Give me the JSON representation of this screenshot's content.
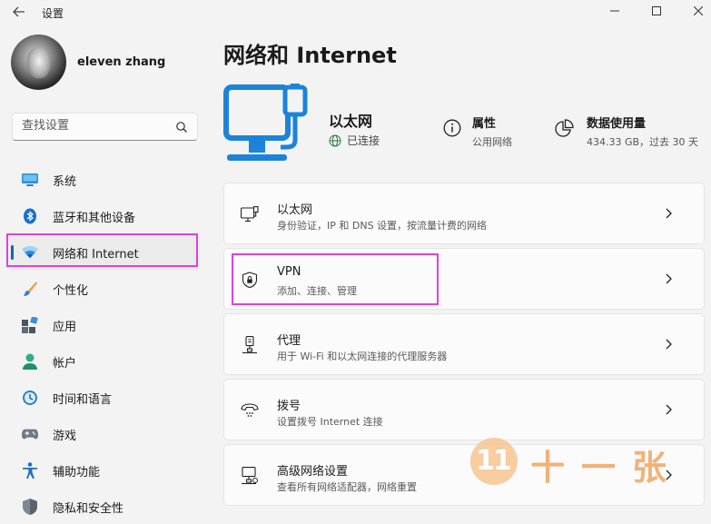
{
  "window": {
    "title": "设置",
    "back_icon": "back-arrow-icon",
    "controls": [
      "minimize-icon",
      "maximize-icon",
      "close-icon"
    ]
  },
  "profile": {
    "name": "eleven zhang"
  },
  "search": {
    "placeholder": "查找设置",
    "icon": "search-icon"
  },
  "sidebar": {
    "items": [
      {
        "label": "系统",
        "icon": "system-icon",
        "active": false
      },
      {
        "label": "蓝牙和其他设备",
        "icon": "bluetooth-icon",
        "active": false
      },
      {
        "label": "网络和 Internet",
        "icon": "wifi-icon",
        "active": true
      },
      {
        "label": "个性化",
        "icon": "brush-icon",
        "active": false
      },
      {
        "label": "应用",
        "icon": "apps-icon",
        "active": false
      },
      {
        "label": "帐户",
        "icon": "account-icon",
        "active": false
      },
      {
        "label": "时间和语言",
        "icon": "time-language-icon",
        "active": false
      },
      {
        "label": "游戏",
        "icon": "gaming-icon",
        "active": false
      },
      {
        "label": "辅助功能",
        "icon": "accessibility-icon",
        "active": false
      },
      {
        "label": "隐私和安全性",
        "icon": "shield-icon",
        "active": false
      }
    ]
  },
  "main": {
    "title": "网络和 Internet",
    "hero": {
      "name": "以太网",
      "status": "已连接",
      "properties": {
        "title": "属性",
        "subtitle": "公用网络"
      },
      "data_usage": {
        "title": "数据使用量",
        "subtitle": "434.33 GB，过去 30 天"
      }
    },
    "cards": [
      {
        "title": "以太网",
        "subtitle": "身份验证，IP 和 DNS 设置，按流量计费的网络",
        "icon": "ethernet-icon"
      },
      {
        "title": "VPN",
        "subtitle": "添加、连接、管理",
        "icon": "vpn-shield-icon"
      },
      {
        "title": "代理",
        "subtitle": "用于 Wi-Fi 和以太网连接的代理服务器",
        "icon": "proxy-icon"
      },
      {
        "title": "拨号",
        "subtitle": "设置拨号 Internet 连接",
        "icon": "dialup-icon"
      },
      {
        "title": "高级网络设置",
        "subtitle": "查看所有网络适配器，网络重置",
        "icon": "advanced-network-icon"
      }
    ]
  },
  "watermark": {
    "number": "11",
    "text": "十一张"
  },
  "colors": {
    "accent": "#0067c0",
    "highlight_box": "#e040e0",
    "watermark": "#f0a663"
  }
}
